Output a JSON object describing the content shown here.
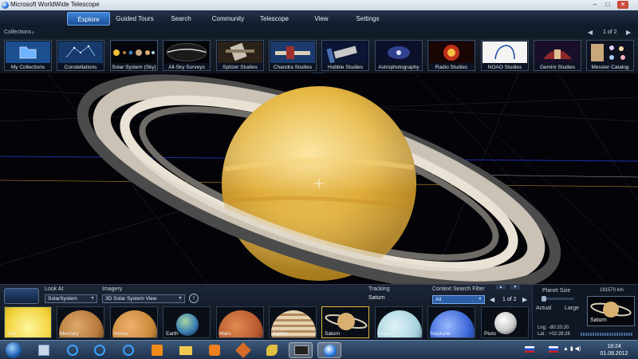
{
  "window": {
    "title": "Microsoft WorldWide Telescope",
    "minimize_label": "–",
    "maximize_label": "□",
    "close_label": "✕"
  },
  "menu": {
    "tabs": [
      "Explore",
      "Guided Tours",
      "Search",
      "Community",
      "Telescope",
      "View",
      "Settings"
    ],
    "active": "Explore"
  },
  "collections": {
    "label": "Collections",
    "arrow": "›",
    "page_indicator": "1 of 2",
    "prev": "◀",
    "next": "▶",
    "items": [
      {
        "label": "My Collections",
        "icon": "folder-icon"
      },
      {
        "label": "Constellations",
        "icon": "constellation-icon"
      },
      {
        "label": "Solar System (Sky)",
        "icon": "solar-system-icon"
      },
      {
        "label": "All-Sky Surveys",
        "icon": "all-sky-icon"
      },
      {
        "label": "Spitzer Studies",
        "icon": "spitzer-icon"
      },
      {
        "label": "Chandra Studies",
        "icon": "chandra-icon"
      },
      {
        "label": "Hubble Studies",
        "icon": "hubble-icon"
      },
      {
        "label": "Astrophotography",
        "icon": "astrophotography-icon"
      },
      {
        "label": "Radio Studies",
        "icon": "radio-icon"
      },
      {
        "label": "NOAO Studies",
        "icon": "noao-icon"
      },
      {
        "label": "Gemini Studies",
        "icon": "gemini-icon"
      },
      {
        "label": "Messier Catalog",
        "icon": "messier-icon"
      }
    ]
  },
  "controls": {
    "look_at_label": "Look At",
    "look_at_value": "SolarSystem",
    "imagery_label": "Imagery",
    "imagery_value": "3D Solar System View",
    "info_label": "i",
    "tracking_label": "Tracking",
    "tracking_value": "Saturn",
    "context_filter_label": "Context Search Filter",
    "context_filter_value": "All",
    "page_indicator": "1 of 2",
    "prev": "◀",
    "next": "▶"
  },
  "planets": [
    {
      "label": "Sun",
      "color": "#f2d13a"
    },
    {
      "label": "Mercury",
      "color": "#b5793c"
    },
    {
      "label": "Venus",
      "color": "#c98a3a"
    },
    {
      "label": "Earth",
      "color": "#3d7fb5"
    },
    {
      "label": "Mars",
      "color": "#b85a2f"
    },
    {
      "label": "Jupiter",
      "color": "#c9a983"
    },
    {
      "label": "Saturn",
      "color": "#d9b070"
    },
    {
      "label": "Uranus",
      "color": "#a9d4e0"
    },
    {
      "label": "Neptune",
      "color": "#3a66d6"
    },
    {
      "label": "Pluto",
      "color": "#c9c9c9"
    }
  ],
  "selected_planet": "Saturn",
  "right_panel": {
    "planet_size_label": "Planet Size",
    "distance": "181570 km",
    "actual_label": "Actual",
    "large_label": "Large",
    "lng_label": "Lng:",
    "lng_value": "-80:20:20",
    "lat_label": "Lat :",
    "lat_value": "+02:28:26",
    "preview_label": "Saturn"
  },
  "taskbar": {
    "time": "18:24",
    "date": "01.08.2012",
    "apps": [
      "explorer-icon",
      "ie-icon",
      "ie-icon",
      "ie-icon",
      "odnoklassniki-icon",
      "folder-icon",
      "media-player-icon",
      "tool-icon",
      "paint-icon",
      "asrock-icon",
      "wwt-icon"
    ]
  },
  "colors": {
    "accent": "#3f86d8",
    "selected": "#e0b640",
    "saturn_body": "#e5b640"
  }
}
